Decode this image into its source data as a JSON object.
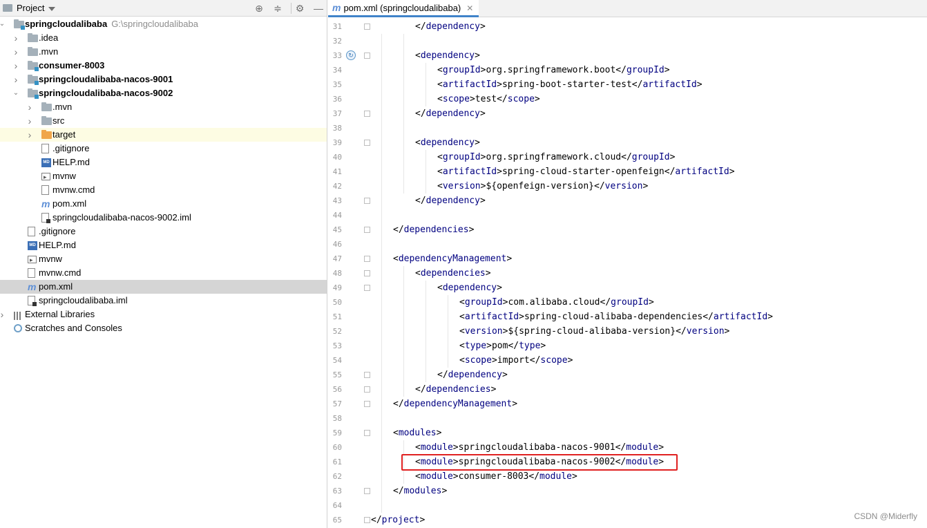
{
  "project_panel": {
    "title": "Project",
    "tree": [
      {
        "label": "springcloudalibaba",
        "path": "G:\\springcloudalibaba",
        "icon": "module-folder-icon",
        "bold": true,
        "arrow": "expanded"
      },
      {
        "label": ".idea",
        "icon": "folder-icon",
        "arrow": "collapsed"
      },
      {
        "label": ".mvn",
        "icon": "folder-icon",
        "arrow": "collapsed"
      },
      {
        "label": "consumer-8003",
        "icon": "module-folder-icon",
        "bold": true,
        "arrow": "collapsed"
      },
      {
        "label": "springcloudalibaba-nacos-9001",
        "icon": "module-folder-icon",
        "bold": true,
        "arrow": "collapsed"
      },
      {
        "label": "springcloudalibaba-nacos-9002",
        "icon": "module-folder-icon",
        "bold": true,
        "arrow": "expanded"
      },
      {
        "label": ".mvn",
        "icon": "folder-icon",
        "arrow": "collapsed"
      },
      {
        "label": "src",
        "icon": "folder-icon",
        "arrow": "collapsed"
      },
      {
        "label": "target",
        "icon": "excluded-folder-icon",
        "arrow": "collapsed"
      },
      {
        "label": ".gitignore",
        "icon": "gitignore-file-icon"
      },
      {
        "label": "HELP.md",
        "icon": "markdown-file-icon"
      },
      {
        "label": "mvnw",
        "icon": "shell-script-icon"
      },
      {
        "label": "mvnw.cmd",
        "icon": "text-file-icon"
      },
      {
        "label": "pom.xml",
        "icon": "maven-file-icon"
      },
      {
        "label": "springcloudalibaba-nacos-9002.iml",
        "icon": "iml-file-icon"
      },
      {
        "label": ".gitignore",
        "icon": "gitignore-file-icon"
      },
      {
        "label": "HELP.md",
        "icon": "markdown-file-icon"
      },
      {
        "label": "mvnw",
        "icon": "shell-script-icon"
      },
      {
        "label": "mvnw.cmd",
        "icon": "text-file-icon"
      },
      {
        "label": "pom.xml",
        "icon": "maven-file-icon"
      },
      {
        "label": "springcloudalibaba.iml",
        "icon": "iml-file-icon"
      },
      {
        "label": "External Libraries",
        "icon": "libraries-icon",
        "arrow": "collapsed"
      },
      {
        "label": "Scratches and Consoles",
        "icon": "scratches-icon"
      }
    ]
  },
  "editor": {
    "tab_label": "pom.xml (springcloudalibaba)",
    "tab_icon": "maven-file-icon",
    "lines": [
      {
        "n": "31",
        "ind": 2,
        "code": "</dependency>"
      },
      {
        "n": "32",
        "ind": 0,
        "code": ""
      },
      {
        "n": "33",
        "ind": 2,
        "code": "<dependency>"
      },
      {
        "n": "34",
        "ind": 3,
        "code": "<groupId>org.springframework.boot</groupId>"
      },
      {
        "n": "35",
        "ind": 3,
        "code": "<artifactId>spring-boot-starter-test</artifactId>"
      },
      {
        "n": "36",
        "ind": 3,
        "code": "<scope>test</scope>"
      },
      {
        "n": "37",
        "ind": 2,
        "code": "</dependency>"
      },
      {
        "n": "38",
        "ind": 0,
        "code": ""
      },
      {
        "n": "39",
        "ind": 2,
        "code": "<dependency>"
      },
      {
        "n": "40",
        "ind": 3,
        "code": "<groupId>org.springframework.cloud</groupId>"
      },
      {
        "n": "41",
        "ind": 3,
        "code": "<artifactId>spring-cloud-starter-openfeign</artifactId>"
      },
      {
        "n": "42",
        "ind": 3,
        "code": "<version>${openfeign-version}</version>"
      },
      {
        "n": "43",
        "ind": 2,
        "code": "</dependency>"
      },
      {
        "n": "44",
        "ind": 0,
        "code": ""
      },
      {
        "n": "45",
        "ind": 1,
        "code": "</dependencies>"
      },
      {
        "n": "46",
        "ind": 0,
        "code": ""
      },
      {
        "n": "47",
        "ind": 1,
        "code": "<dependencyManagement>"
      },
      {
        "n": "48",
        "ind": 2,
        "code": "<dependencies>"
      },
      {
        "n": "49",
        "ind": 3,
        "code": "<dependency>"
      },
      {
        "n": "50",
        "ind": 4,
        "code": "<groupId>com.alibaba.cloud</groupId>"
      },
      {
        "n": "51",
        "ind": 4,
        "code": "<artifactId>spring-cloud-alibaba-dependencies</artifactId>"
      },
      {
        "n": "52",
        "ind": 4,
        "code": "<version>${spring-cloud-alibaba-version}</version>"
      },
      {
        "n": "53",
        "ind": 4,
        "code": "<type>pom</type>"
      },
      {
        "n": "54",
        "ind": 4,
        "code": "<scope>import</scope>"
      },
      {
        "n": "55",
        "ind": 3,
        "code": "</dependency>"
      },
      {
        "n": "56",
        "ind": 2,
        "code": "</dependencies>"
      },
      {
        "n": "57",
        "ind": 1,
        "code": "</dependencyManagement>"
      },
      {
        "n": "58",
        "ind": 0,
        "code": ""
      },
      {
        "n": "59",
        "ind": 1,
        "code": "<modules>"
      },
      {
        "n": "60",
        "ind": 2,
        "code": "<module>springcloudalibaba-nacos-9001</module>"
      },
      {
        "n": "61",
        "ind": 2,
        "code": "<module>springcloudalibaba-nacos-9002</module>",
        "highlight": true
      },
      {
        "n": "62",
        "ind": 2,
        "code": "<module>consumer-8003</module>"
      },
      {
        "n": "63",
        "ind": 1,
        "code": "</modules>"
      },
      {
        "n": "64",
        "ind": 0,
        "code": ""
      },
      {
        "n": "65",
        "ind": 0,
        "code": "</project>"
      }
    ],
    "gutter_mark_line": "33",
    "highlight_color": "#e02020"
  },
  "watermark": "CSDN @Miderfly"
}
